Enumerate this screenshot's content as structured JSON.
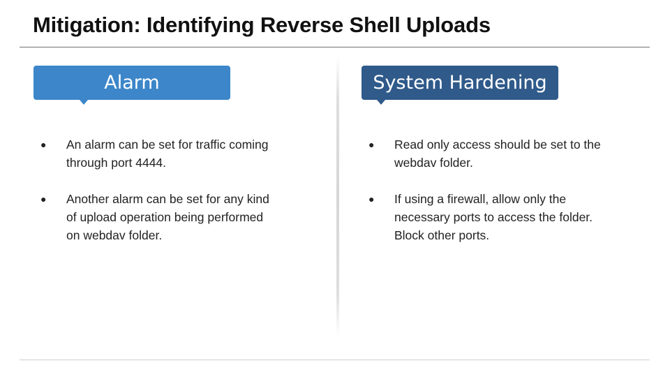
{
  "slide": {
    "title": "Mitigation: Identifying Reverse Shell Uploads"
  },
  "left": {
    "heading": "Alarm",
    "bullets": [
      "An alarm can be set for traffic coming through port 4444.",
      "Another alarm can be set for any kind of upload operation being performed on webdav folder."
    ]
  },
  "right": {
    "heading": "System Hardening",
    "bullets": [
      "Read only access should be set to the webdav folder.",
      "If using a firewall, allow only the necessary ports to access the folder. Block other ports."
    ]
  },
  "icons": {
    "bullet": "bullet-dot-icon"
  },
  "colors": {
    "alarm_callout": "#3c86c9",
    "hardening_callout": "#2f5a8a"
  }
}
